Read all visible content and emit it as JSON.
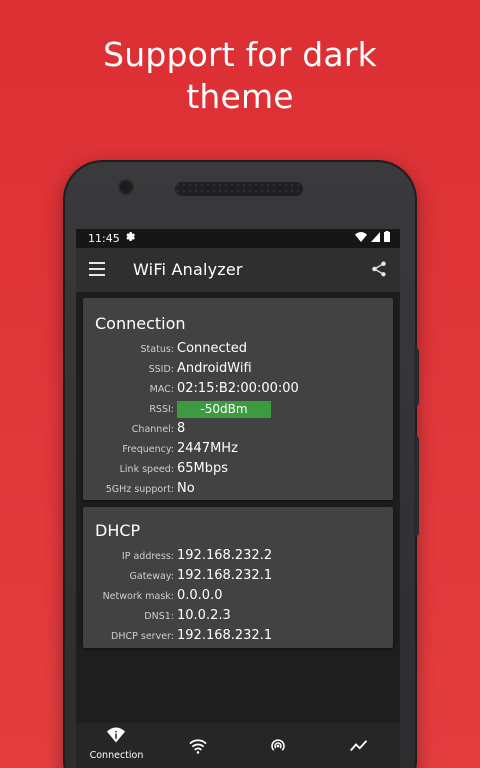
{
  "promo": {
    "line1": "Support for dark",
    "line2": "theme"
  },
  "statusbar": {
    "time": "11:45"
  },
  "appbar": {
    "title": "WiFi Analyzer"
  },
  "connection": {
    "title": "Connection",
    "rows": [
      {
        "label": "Status:",
        "value": "Connected"
      },
      {
        "label": "SSID:",
        "value": "AndroidWifi"
      },
      {
        "label": "MAC:",
        "value": "02:15:B2:00:00:00"
      },
      {
        "label": "RSSI:",
        "value": "-50dBm"
      },
      {
        "label": "Channel:",
        "value": "8"
      },
      {
        "label": "Frequency:",
        "value": "2447MHz"
      },
      {
        "label": "Link speed:",
        "value": "65Mbps"
      },
      {
        "label": "5GHz support:",
        "value": "No"
      }
    ]
  },
  "dhcp": {
    "title": "DHCP",
    "rows": [
      {
        "label": "IP address:",
        "value": "192.168.232.2"
      },
      {
        "label": "Gateway:",
        "value": "192.168.232.1"
      },
      {
        "label": "Network mask:",
        "value": "0.0.0.0"
      },
      {
        "label": "DNS1:",
        "value": "10.0.2.3"
      },
      {
        "label": "DHCP server:",
        "value": "192.168.232.1"
      }
    ]
  },
  "bottomnav": {
    "connection_label": "Connection"
  },
  "colors": {
    "background": "#dc2f34",
    "rssi_good": "#3c9a3f"
  },
  "icons": [
    "settings-icon",
    "wifi-icon",
    "signal-icon",
    "battery-icon",
    "menu-icon",
    "share-icon",
    "wifi-info-icon",
    "wifi-icon",
    "radar-icon",
    "graph-icon"
  ]
}
